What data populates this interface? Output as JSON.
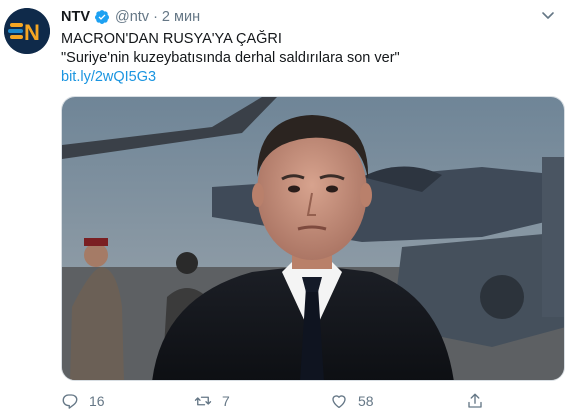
{
  "tweet": {
    "author_name": "NTV",
    "handle": "@ntv",
    "separator": "·",
    "time": "2 мин",
    "lines": [
      "MACRON'DAN RUSYA'YA ÇAĞRI",
      "\"Suriye'nin kuzeybatısında derhal saldırılara son ver\""
    ],
    "link": "bit.ly/2wQI5G3",
    "avatar_logo_text": "N"
  },
  "actions": {
    "reply_count": "16",
    "retweet_count": "7",
    "like_count": "58"
  },
  "colors": {
    "verified": "#1da1f2",
    "link": "#1b95e0",
    "muted": "#657786",
    "logo_orange": "#f5a623",
    "logo_blue": "#1e88c8"
  },
  "icons": [
    "verified-badge-icon",
    "chevron-down-icon",
    "reply-icon",
    "retweet-icon",
    "like-icon",
    "share-icon"
  ]
}
